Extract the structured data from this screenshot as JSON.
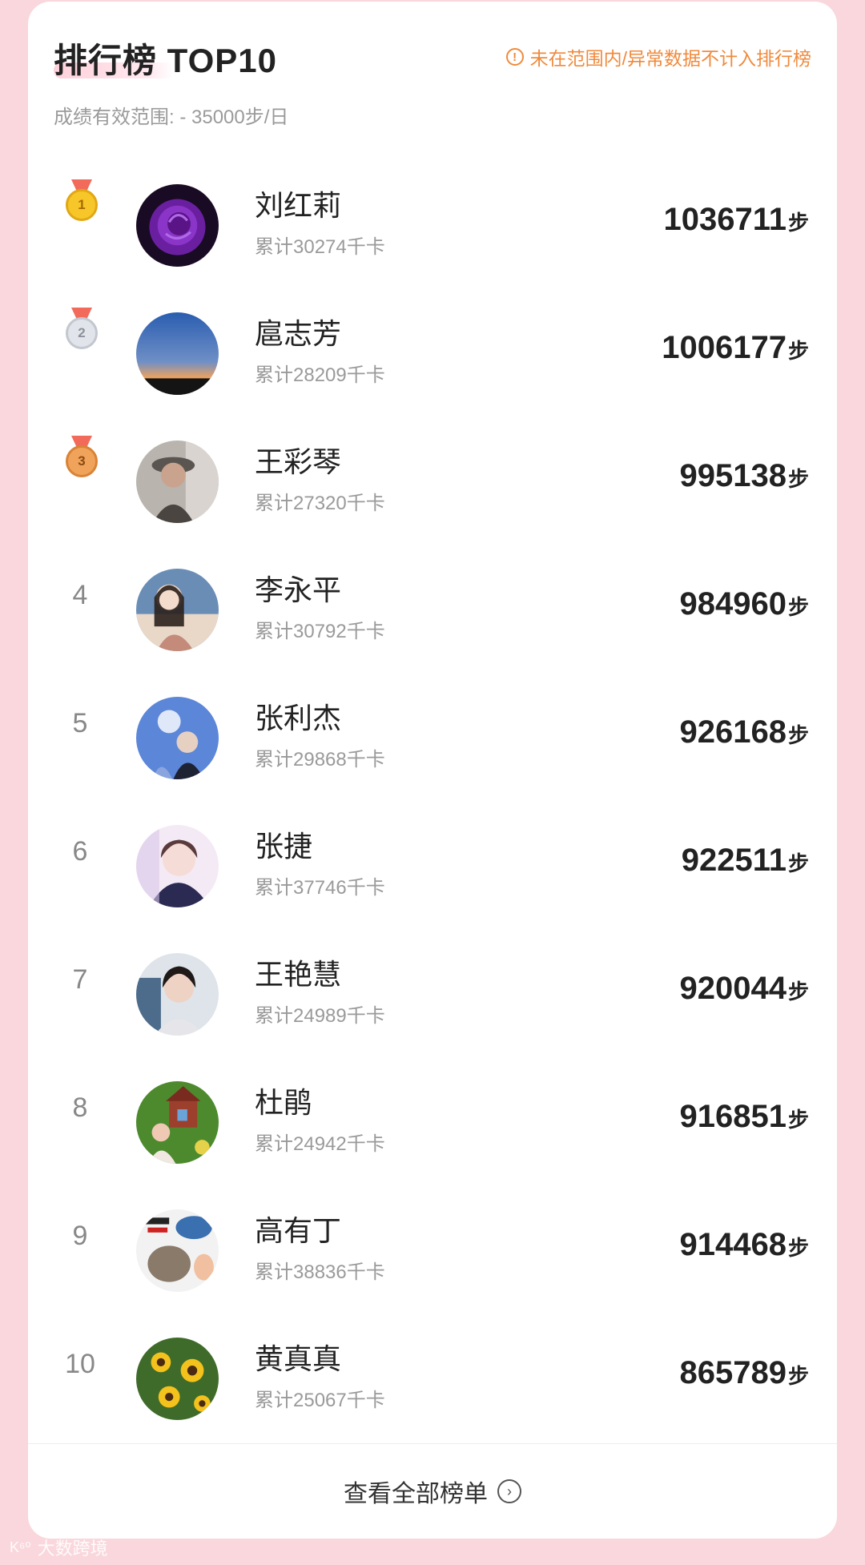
{
  "header": {
    "title": "排行榜 TOP10",
    "note": "未在范围内/异常数据不计入排行榜",
    "note_icon": "!",
    "subtitle": "成绩有效范围: - 35000步/日"
  },
  "colors": {
    "page_bg": "#f9d7dc",
    "note_orange": "#f08a3c",
    "gold": "#f7c629",
    "silver": "#e1e4ea",
    "bronze": "#f0a35a"
  },
  "leaderboard": [
    {
      "rank": "1",
      "medal": "gold",
      "name": "刘红莉",
      "kcal": "累计30274千卡",
      "steps": "1036711",
      "unit": "步",
      "avatar": "purple-rose"
    },
    {
      "rank": "2",
      "medal": "silver",
      "name": "扈志芳",
      "kcal": "累计28209千卡",
      "steps": "1006177",
      "unit": "步",
      "avatar": "sunset-sky"
    },
    {
      "rank": "3",
      "medal": "bronze",
      "name": "王彩琴",
      "kcal": "累计27320千卡",
      "steps": "995138",
      "unit": "步",
      "avatar": "woman-hat"
    },
    {
      "rank": "4",
      "medal": "",
      "name": "李永平",
      "kcal": "累计30792千卡",
      "steps": "984960",
      "unit": "步",
      "avatar": "illustrated-girl"
    },
    {
      "rank": "5",
      "medal": "",
      "name": "张利杰",
      "kcal": "累计29868千卡",
      "steps": "926168",
      "unit": "步",
      "avatar": "blue-bubble"
    },
    {
      "rank": "6",
      "medal": "",
      "name": "张捷",
      "kcal": "累计37746千卡",
      "steps": "922511",
      "unit": "步",
      "avatar": "portrait-girl"
    },
    {
      "rank": "7",
      "medal": "",
      "name": "王艳慧",
      "kcal": "累计24989千卡",
      "steps": "920044",
      "unit": "步",
      "avatar": "portrait-woman"
    },
    {
      "rank": "8",
      "medal": "",
      "name": "杜鹃",
      "kcal": "累计24942千卡",
      "steps": "916851",
      "unit": "步",
      "avatar": "garden-child"
    },
    {
      "rank": "9",
      "medal": "",
      "name": "高有丁",
      "kcal": "累计38836千卡",
      "steps": "914468",
      "unit": "步",
      "avatar": "meme-collage"
    },
    {
      "rank": "10",
      "medal": "",
      "name": "黄真真",
      "kcal": "累计25067千卡",
      "steps": "865789",
      "unit": "步",
      "avatar": "sunflowers"
    }
  ],
  "footer": {
    "label": "查看全部榜单",
    "icon": "chevron-right-circle-icon"
  },
  "watermark": {
    "logo": "K⁶⁰",
    "text": "大数跨境"
  }
}
